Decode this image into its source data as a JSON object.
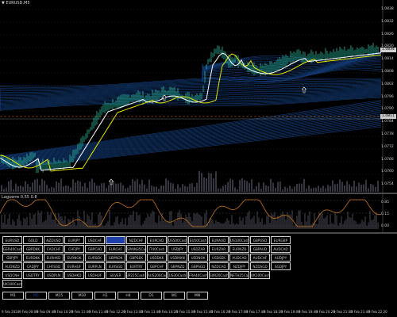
{
  "window": {
    "symbol_title": "▼ EURUSD,M5",
    "indicator_title": "Laguerre 0.55 0.8",
    "colors": {
      "background": "#000000",
      "bands": "#1e5fbf",
      "ma_white": "#ffffff",
      "ma_yellow": "#e6e600",
      "candles": "#2ec4a5",
      "indicator_line": "#c8731e",
      "volume": "#5a5a6a"
    }
  },
  "price_axis": {
    "labels": [
      "1.0838",
      "1.0832",
      "1.0826",
      "1.0820",
      "1.0814",
      "1.0808",
      "1.0802",
      "1.0796",
      "1.0790",
      "1.0784",
      "1.0778",
      "1.0772",
      "1.0766",
      "1.0760",
      "1.0754"
    ],
    "current_price": "1.0811",
    "ask_price": "1.0834"
  },
  "indicator_axis": {
    "labels": [
      "0.85",
      "0.15",
      "0.00"
    ]
  },
  "symbols": [
    [
      "EURUSD",
      "GOLD",
      "NZDUSD",
      "EURJPY",
      "USDCHF",
      "USDJPY",
      "NZDCHF",
      "EURCAD",
      "US500Cash",
      "EU50Cash",
      "EURAUD",
      "US100Cash",
      "GBPUSD",
      "EURGBP"
    ],
    [
      "GER40Cash",
      "GBPDKK",
      "CADCHF",
      "CHFJPY",
      "GBPCAD",
      "EURCHF",
      "SPAIN35Cash",
      "IT40Cash",
      "USDJPY",
      "USDZAR",
      "EURZAR",
      "EURNZD",
      "GBPAUD",
      "AUDCAD"
    ],
    [
      "GBPJPY",
      "EURDKK",
      "EURHKD",
      "EURNOK",
      "EURSEK",
      "GBPNOK",
      "GBPSEK",
      "USDDKK",
      "USDMXN",
      "USDNOK",
      "USDSEK",
      "AUDCAD",
      "AUDCHF",
      "AUDJPY"
    ],
    [
      "AUDNZD",
      "CADJPY",
      "CHFSGD",
      "EURHUF",
      "EURPLN",
      "EURSGD",
      "EURTRY",
      "GBPCHF",
      "GBPNZD",
      "GBPSGD",
      "NZDCAD",
      "NZDJPY",
      "NZDSGD",
      "SGDJPY"
    ],
    [
      "USDCNH",
      "USDTRY",
      "USDPLN",
      "USDHKD",
      "USDHUF",
      "SILVER",
      "JP225Cash",
      "AUS200Cash",
      "US30Cash",
      "FRA40Cash",
      "SWI20Cash",
      "NETH25Cash",
      "UK100Cash",
      ""
    ],
    [
      "UK100Cash"
    ]
  ],
  "active_symbol": "USDJPY",
  "timeframes": [
    "M1",
    "M5",
    "M15",
    "M30",
    "H1",
    "H4",
    "D1",
    "W1",
    "MN"
  ],
  "active_timeframe": "M5",
  "time_axis": {
    "labels": [
      "9 Feb 2024",
      "9 Feb 09:00",
      "9 Feb 09:40",
      "9 Feb 10:20",
      "9 Feb 11:00",
      "9 Feb 11:40",
      "9 Feb 12:20",
      "9 Feb 13:00",
      "9 Feb 13:40",
      "9 Feb 14:20",
      "9 Feb 15:00",
      "9 Feb 15:40",
      "9 Feb 16:20",
      "9 Feb 17:00",
      "9 Feb 17:40",
      "9 Feb 18:20",
      "9 Feb 19:00",
      "9 Feb 19:40",
      "9 Feb 20:20",
      "9 Feb 21:00",
      "9 Feb 21:40",
      "9 Feb 22:20"
    ]
  }
}
